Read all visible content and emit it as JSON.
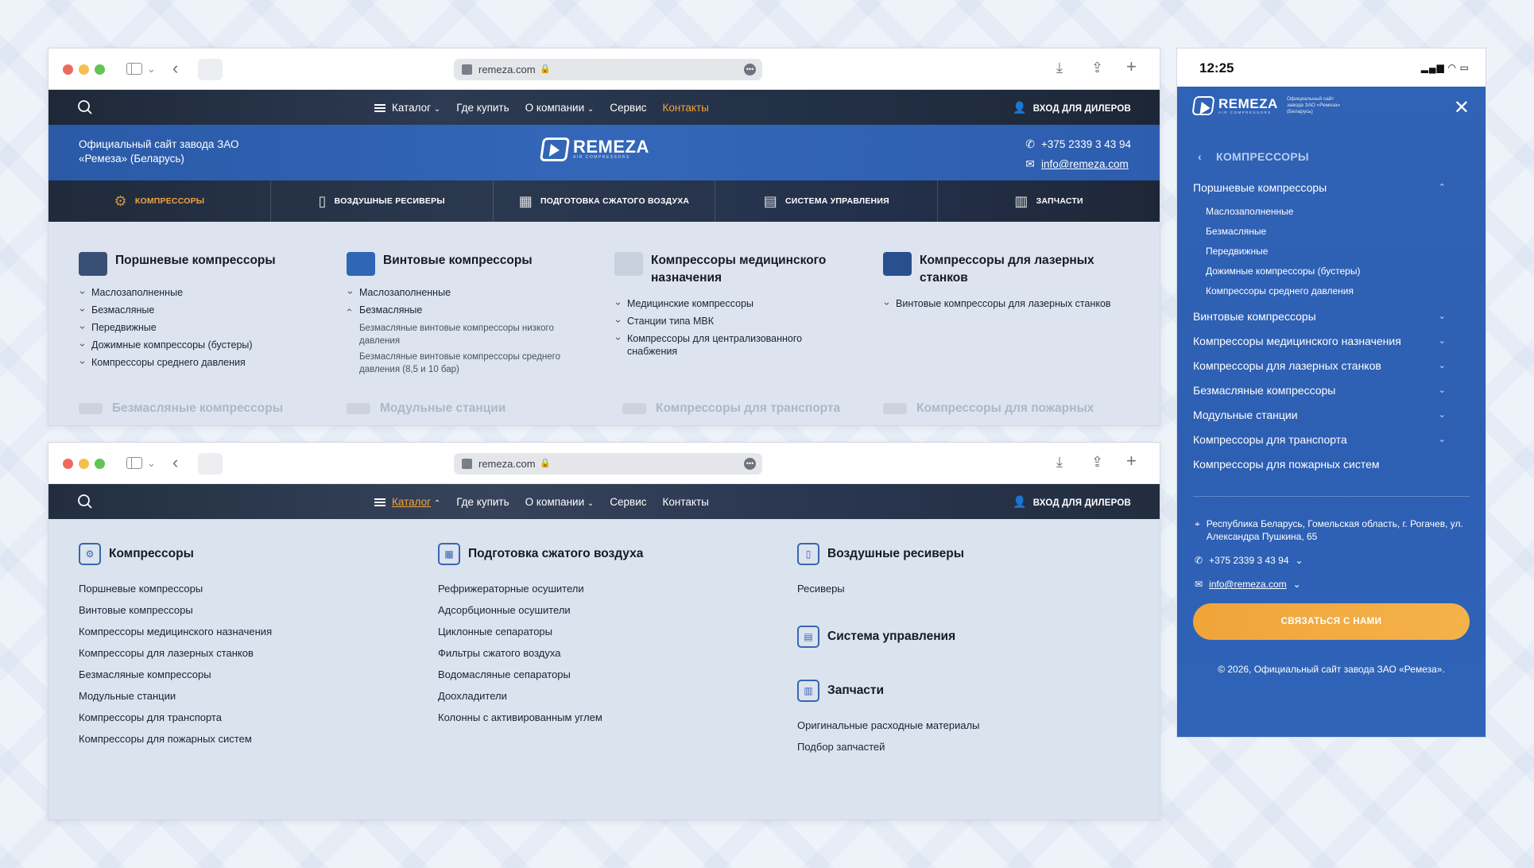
{
  "browser": {
    "url": "remeza.com"
  },
  "nav": {
    "catalog": "Каталог",
    "where": "Где купить",
    "about": "О компании",
    "service": "Сервис",
    "contacts": "Контакты",
    "dealer": "ВХОД ДЛЯ ДИЛЕРОВ"
  },
  "header": {
    "official": "Официальный сайт завода ЗАО «Ремеза» (Беларусь)",
    "brand": "REMEZA",
    "brand_sub": "AIR COMPRESSORS",
    "phone": "+375 2339 3 43 94",
    "email": "info@remeza.com"
  },
  "catbar": [
    "КОМПРЕССОРЫ",
    "ВОЗДУШНЫЕ РЕСИВЕРЫ",
    "ПОДГОТОВКА СЖАТОГО ВОЗДУХА",
    "СИСТЕМА УПРАВЛЕНИЯ",
    "ЗАПЧАСТИ"
  ],
  "menu1": {
    "c1": {
      "title": "Поршневые компрессоры",
      "items": [
        "Маслозаполненные",
        "Безмасляные",
        "Передвижные",
        "Дожимные компрессоры (бустеры)",
        "Компрессоры среднего давления"
      ]
    },
    "c2": {
      "title": "Винтовые компрессоры",
      "items": [
        "Маслозаполненные",
        "Безмасляные"
      ],
      "sub": [
        "Безмасляные винтовые компрессоры низкого давления",
        "Безмасляные винтовые компрессоры среднего давления (8,5 и 10 бар)"
      ]
    },
    "c3": {
      "title": "Компрессоры медицинского назначения",
      "items": [
        "Медицинские компрессоры",
        "Станции типа МВК",
        "Компрессоры для централизованного снабжения"
      ]
    },
    "c4": {
      "title": "Компрессоры для лазерных станков",
      "items": [
        "Винтовые компрессоры для лазерных станков"
      ]
    },
    "faded": [
      "Безмасляные компрессоры",
      "Модульные станции",
      "Компрессоры для транспорта",
      "Компрессоры для пожарных"
    ]
  },
  "menu2": {
    "c1": {
      "title": "Компрессоры",
      "items": [
        "Поршневые компрессоры",
        "Винтовые компрессоры",
        "Компрессоры медицинского назначения",
        "Компрессоры для лазерных станков",
        "Безмасляные компрессоры",
        "Модульные станции",
        "Компрессоры для транспорта",
        "Компрессоры для пожарных систем"
      ]
    },
    "c2": {
      "title": "Подготовка сжатого воздуха",
      "items": [
        "Рефрижераторные осушители",
        "Адсорбционные осушители",
        "Циклонные сепараторы",
        "Фильтры сжатого воздуха",
        "Водомасляные сепараторы",
        "Доохладители",
        "Колонны с активированным углем"
      ]
    },
    "c3": {
      "title": "Воздушные ресиверы",
      "items": [
        "Ресиверы"
      ]
    },
    "c4": {
      "title": "Система управления"
    },
    "c5": {
      "title": "Запчасти",
      "items": [
        "Оригинальные расходные материалы",
        "Подбор запчастей"
      ]
    }
  },
  "phone": {
    "time": "12:25",
    "info": "Официальный сайт завода ЗАО «Ремеза» (Беларусь)",
    "section": "КОМПРЕССОРЫ",
    "open_item": "Поршневые компрессоры",
    "sub": [
      "Маслозаполненные",
      "Безмасляные",
      "Передвижные",
      "Дожимные компрессоры (бустеры)",
      "Компрессоры среднего давления"
    ],
    "items": [
      "Винтовые компрессоры",
      "Компрессоры медицинского назначения",
      "Компрессоры для лазерных станков",
      "Безмасляные компрессоры",
      "Модульные станции",
      "Компрессоры для транспорта",
      "Компрессоры для пожарных систем"
    ],
    "address": "Республика Беларусь, Гомельская область, г. Рогачев, ул. Александра Пушкина, 65",
    "phone": "+375 2339 3 43 94",
    "email": "info@remeza.com",
    "button": "СВЯЗАТЬСЯ С НАМИ",
    "footer": "© 2026, Официальный сайт завода ЗАО «Ремеза»."
  },
  "colors": {
    "accent": "#f3a33a",
    "brand_blue": "#2f62b4",
    "dark_nav": "#1e2838"
  }
}
